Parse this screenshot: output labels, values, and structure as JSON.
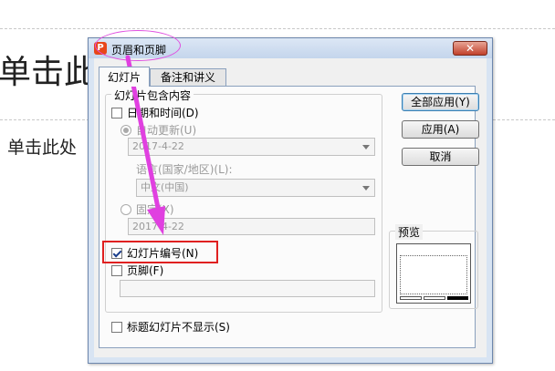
{
  "slide": {
    "title_text": "单击此",
    "subtitle_text": "单击此处"
  },
  "dialog": {
    "title": "页眉和页脚",
    "close_label": "✕",
    "tabs": [
      {
        "label": "幻灯片"
      },
      {
        "label": "备注和讲义"
      }
    ],
    "group_include": "幻灯片包含内容",
    "date_time": {
      "label": "日期和时间(D)",
      "checked": false
    },
    "auto_update": {
      "label": "自动更新(U)",
      "selected": true
    },
    "auto_date_value": "2017-4-22",
    "language_label": "语言(国家/地区)(L):",
    "language_value": "中文(中国)",
    "fixed": {
      "label": "固定(X)",
      "selected": false
    },
    "fixed_value": "2017-4-22",
    "slide_number": {
      "label": "幻灯片编号(N)",
      "checked": true
    },
    "footer": {
      "label": "页脚(F)",
      "checked": false
    },
    "footer_value": "",
    "hide_title": {
      "label": "标题幻灯片不显示(S)",
      "checked": false
    },
    "buttons": {
      "apply_all": "全部应用(Y)",
      "apply": "应用(A)",
      "cancel": "取消"
    },
    "preview_label": "预览"
  },
  "colors": {
    "annotation_ellipse": "#e050e0",
    "annotation_rect": "#e02020",
    "annotation_arrow": "#e040e0"
  }
}
